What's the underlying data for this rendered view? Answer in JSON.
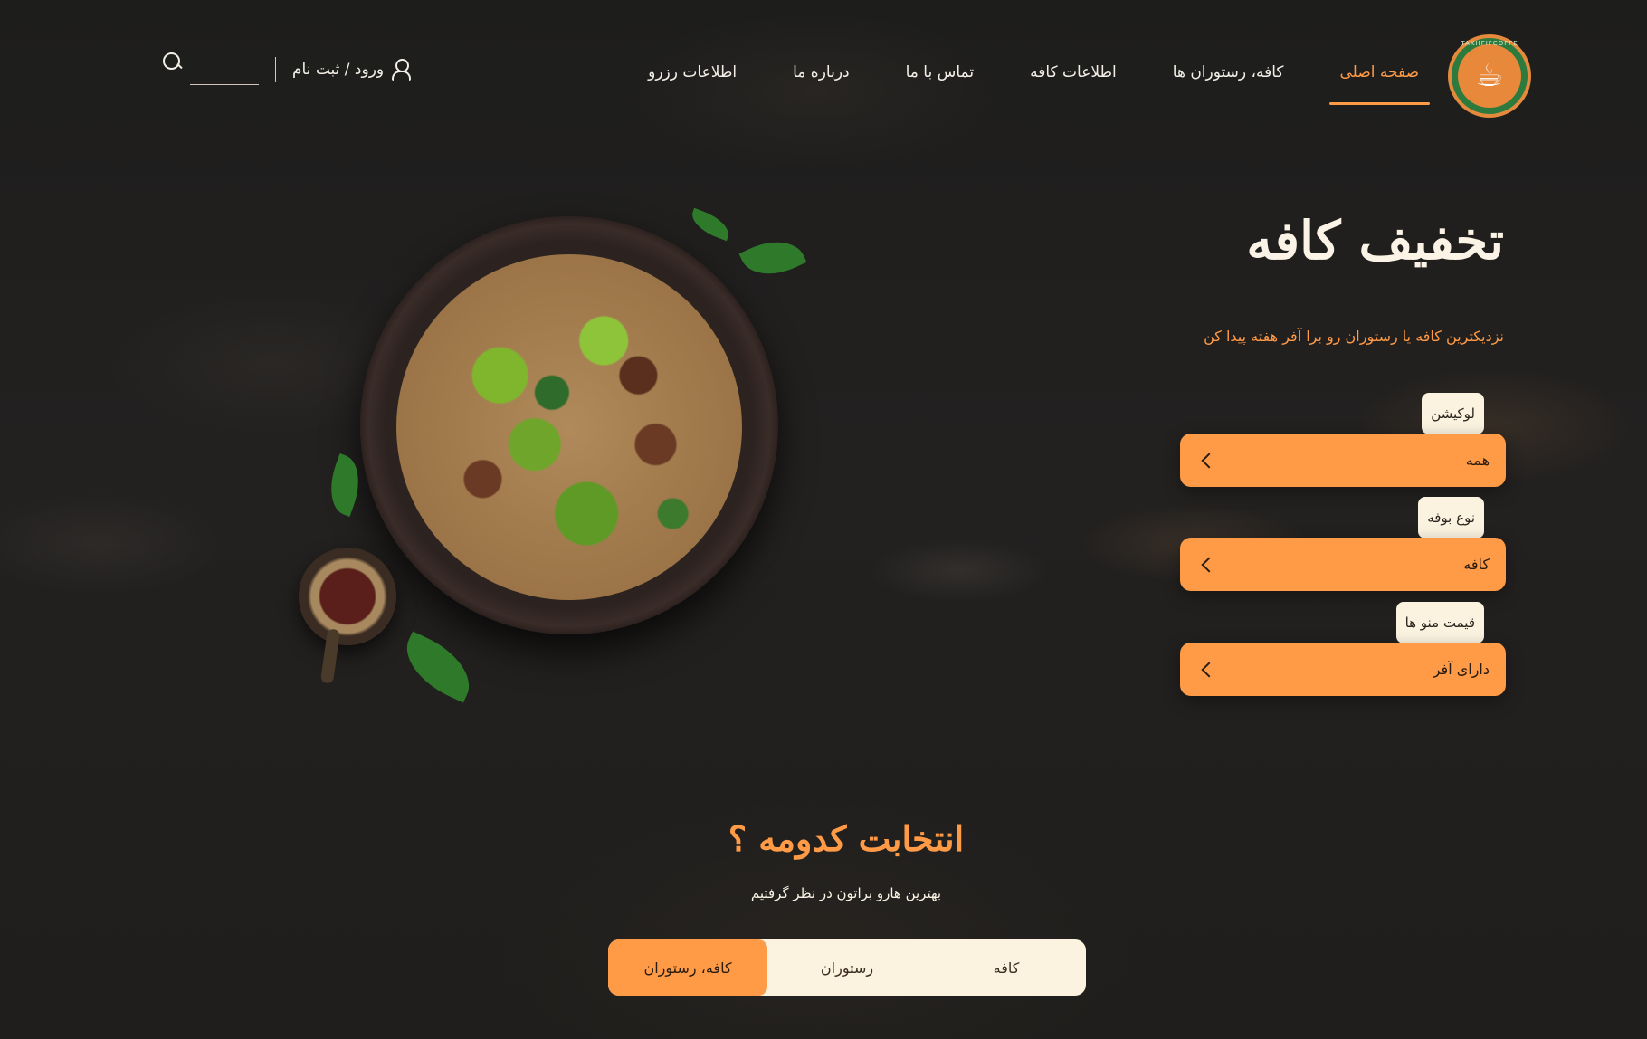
{
  "logo": {
    "text": "TAKHFIFCOFFE",
    "icon": "coffee-cup-icon"
  },
  "nav": {
    "items": [
      {
        "label": "صفحه اصلی",
        "active": true
      },
      {
        "label": "کافه، رستوران ها",
        "active": false
      },
      {
        "label": "اطلاعات کافه",
        "active": false
      },
      {
        "label": "تماس با ما",
        "active": false
      },
      {
        "label": "درباره ما",
        "active": false
      },
      {
        "label": "اطلاعات رزرو",
        "active": false
      }
    ]
  },
  "header": {
    "auth_label": "ورود / ثبت نام",
    "search_value": "",
    "search_placeholder": ""
  },
  "hero": {
    "title": "تخفیف کافه",
    "subtitle": "نزدیکترین کافه یا رستوران رو برا آفر هفته پیدا کن"
  },
  "filters": [
    {
      "label": "لوکیشن",
      "value": "همه"
    },
    {
      "label": "نوع بوفه",
      "value": "کافه"
    },
    {
      "label": "قیمت منو ها",
      "value": "دارای آفر"
    }
  ],
  "section": {
    "title": "انتخابت کدومه ؟",
    "subtitle": "بهترین هارو براتون در نظر گرفتیم",
    "tabs": [
      {
        "label": "کافه",
        "active": false
      },
      {
        "label": "رستوران",
        "active": false
      },
      {
        "label": "کافه، رستوران",
        "active": true
      }
    ]
  },
  "colors": {
    "accent": "#ff9a46",
    "cream": "#fbf2df",
    "background": "#1c1b1a"
  }
}
